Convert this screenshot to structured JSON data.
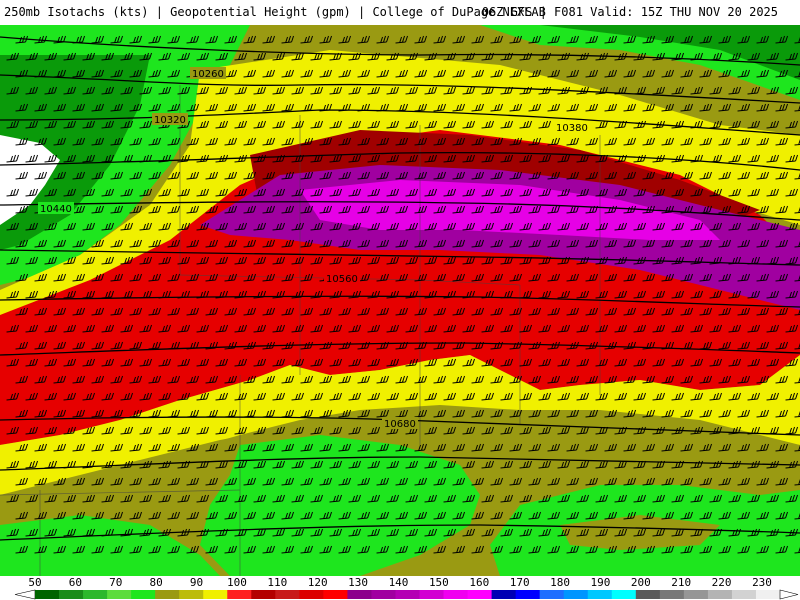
{
  "header": {
    "left_text": "250mb Isotachs (kts) | Geopotential Height (gpm) | College of DuPage NEXLAB",
    "right_text": "06Z GFS | F081 Valid: 15Z THU NOV 20 2025"
  },
  "contour_labels": [
    "10260",
    "10320",
    "10380",
    "10440",
    "10560",
    "10680"
  ],
  "colorbar": {
    "labels": [
      "50",
      "60",
      "70",
      "80",
      "90",
      "100",
      "110",
      "120",
      "130",
      "140",
      "150",
      "160",
      "170",
      "180",
      "190",
      "200",
      "210",
      "220",
      "230"
    ],
    "colors": [
      "#006400",
      "#1a8c1a",
      "#2db82d",
      "#5cdc3c",
      "#1ee61e",
      "#9a9a12",
      "#bcbc0a",
      "#f0f000",
      "#ff2020",
      "#b40000",
      "#c81a1a",
      "#dc0000",
      "#ff0000",
      "#8c008c",
      "#a000a0",
      "#b400b4",
      "#d200d2",
      "#f000f0",
      "#ff00ff",
      "#0000b4",
      "#0000ff",
      "#1e6eff",
      "#0096ff",
      "#00c8ff",
      "#00ffff",
      "#5a5a5a",
      "#787878",
      "#969696",
      "#b4b4b4",
      "#d2d2d2",
      "#f0f0f0"
    ]
  },
  "palette": {
    "green_dark": "#0a9a0a",
    "green": "#1ee61e",
    "olive": "#9a9a12",
    "yellow": "#f0f000",
    "red_dark": "#a00000",
    "red": "#e60000",
    "purple": "#a000a0",
    "magenta": "#e600e6",
    "white": "#ffffff"
  }
}
